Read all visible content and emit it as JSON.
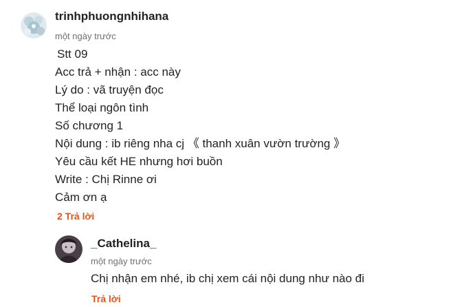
{
  "comment": {
    "author": "trinhphuongnhihana",
    "time": "một ngày trước",
    "lines": [
      "Stt 09",
      "Acc trả + nhận : acc này",
      "Lý do : vã truyện đọc",
      "Thể loại ngôn tình",
      "Số chương 1",
      "Nội dung : ib riêng nha cj 《 thanh xuân vườn trường 》",
      "Yêu cầu kết HE nhưng hơi buồn",
      "Write : Chị Rinne ơi",
      "Cảm ơn ạ"
    ],
    "replies_link": "2 Trả lời"
  },
  "reply": {
    "author": "_Cathelina_",
    "time": "một ngày trước",
    "text": "Chị nhận em nhé, ib chị xem cái nội dung như nào đi",
    "reply_link": "Trả lời"
  },
  "colors": {
    "accent": "#e0551e",
    "text": "#222222",
    "muted": "#6f6f6f"
  }
}
